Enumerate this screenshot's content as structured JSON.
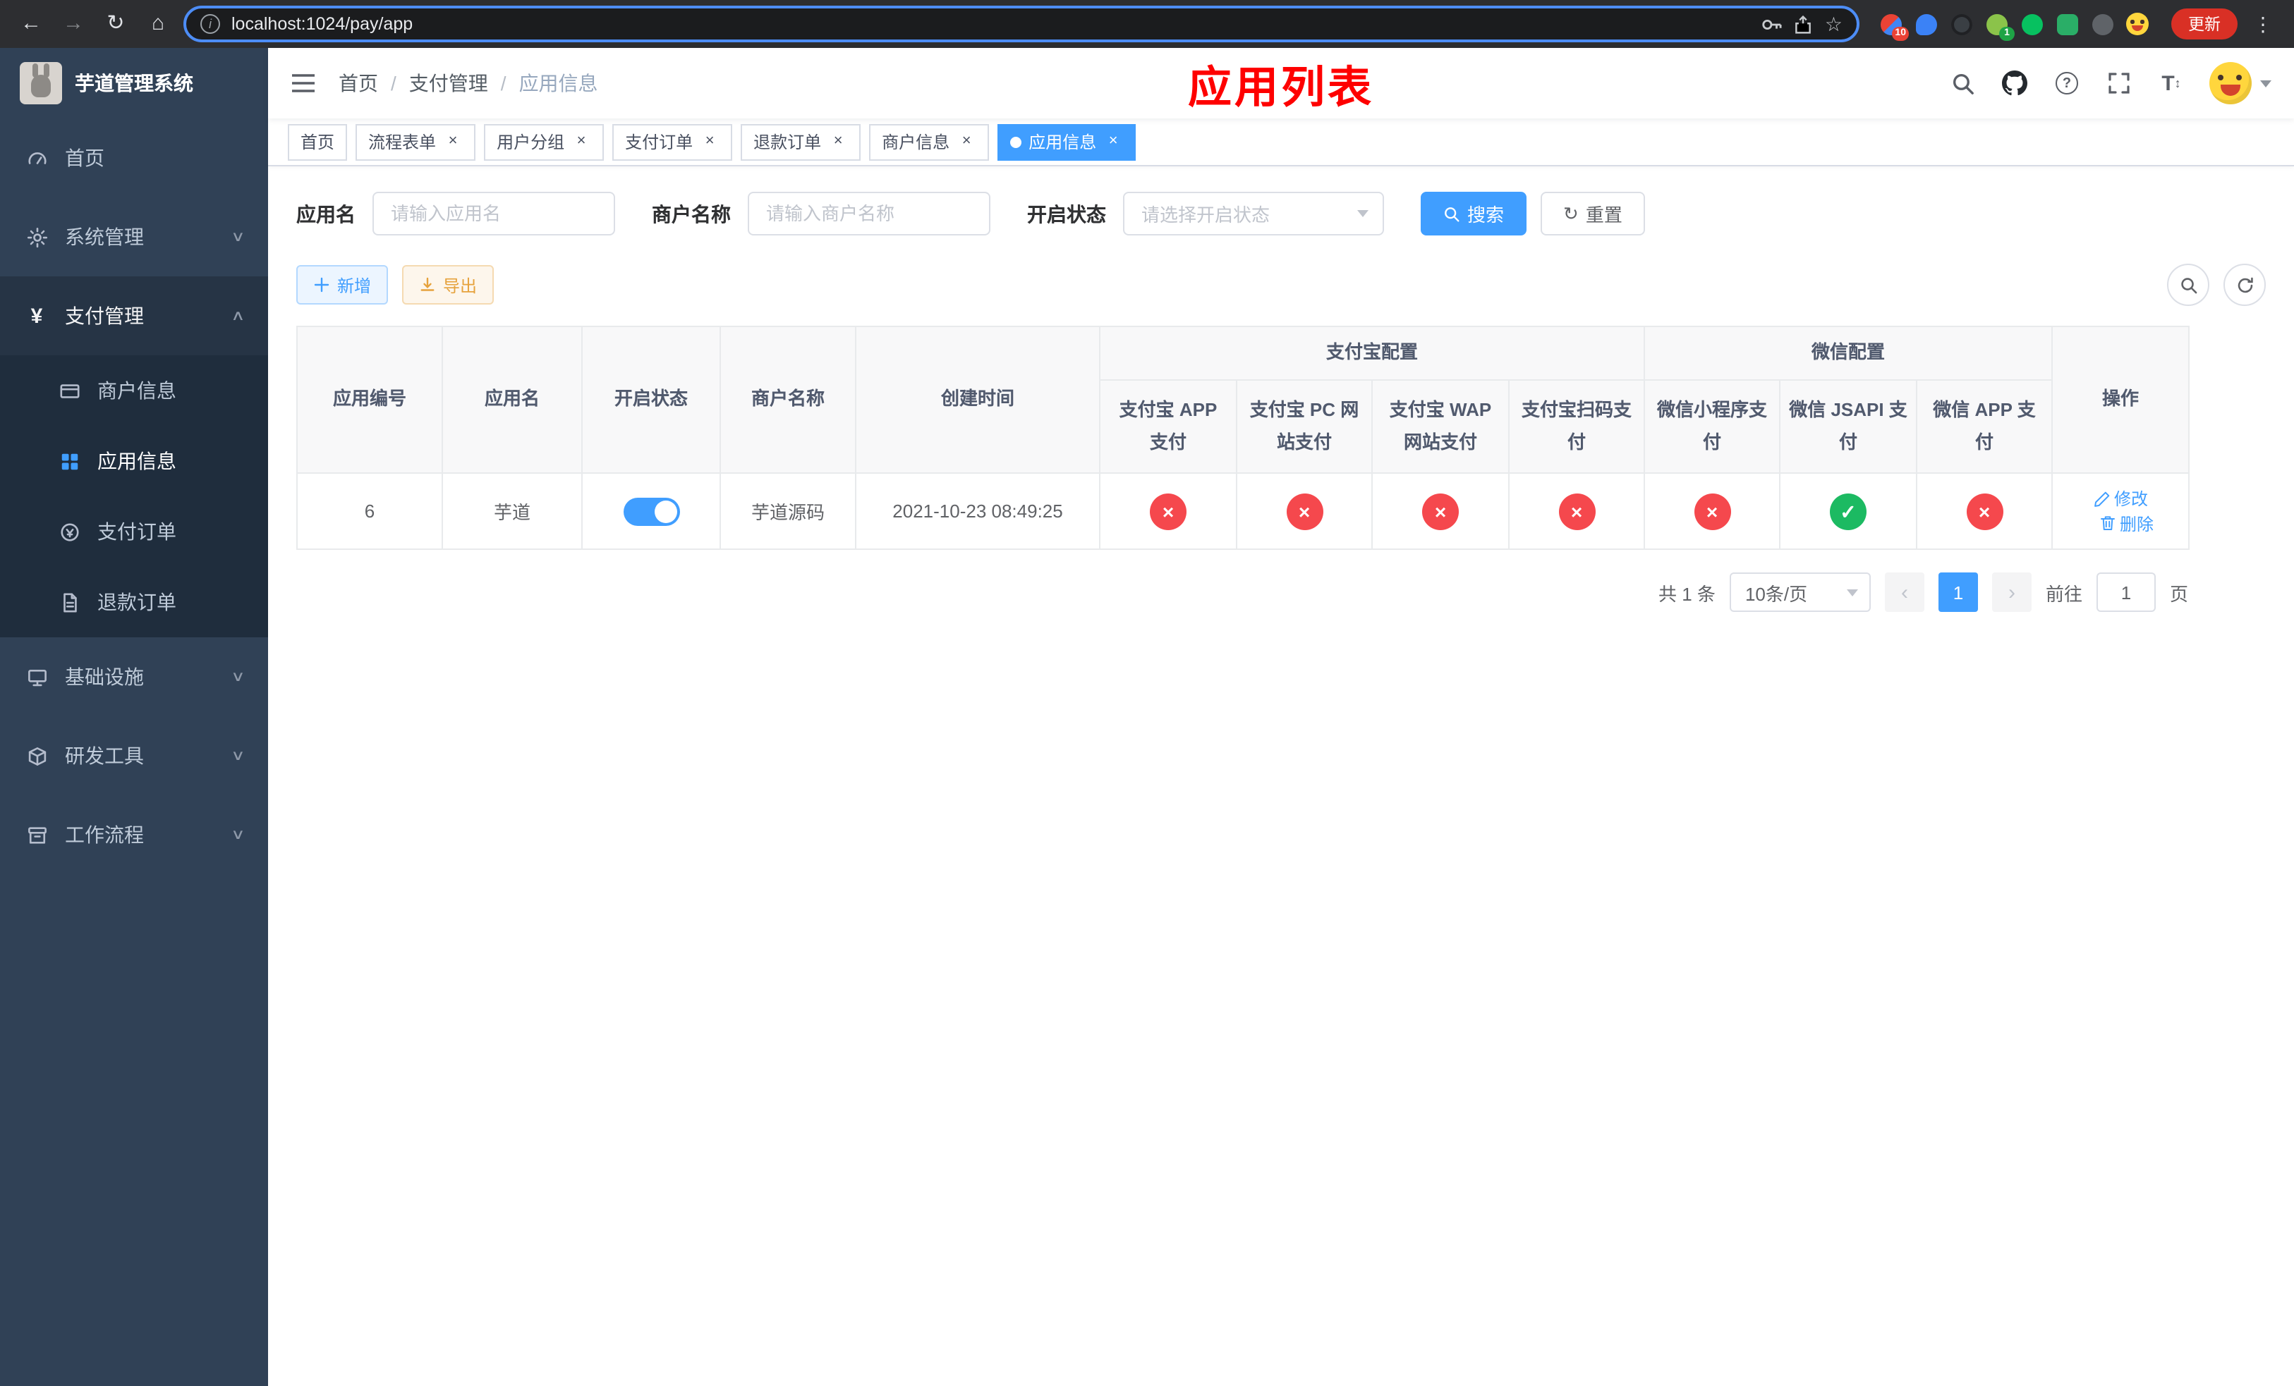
{
  "colors": {
    "accent": "#409EFF",
    "danger": "#f5484d",
    "success": "#1cba62",
    "warning": "#e6a23c",
    "title-red": "#fe0000",
    "sidebar-bg": "#304156",
    "sidebar-sub-bg": "#1f2d3d"
  },
  "browser": {
    "url": "localhost:1024/pay/app",
    "update_label": "更新",
    "ext_badge_count": "10",
    "ext_badge_green": "1"
  },
  "sidebar": {
    "title": "芋道管理系统",
    "items": [
      {
        "label": "首页"
      },
      {
        "label": "系统管理"
      },
      {
        "label": "支付管理",
        "children": [
          {
            "label": "商户信息"
          },
          {
            "label": "应用信息"
          },
          {
            "label": "支付订单"
          },
          {
            "label": "退款订单"
          }
        ]
      },
      {
        "label": "基础设施"
      },
      {
        "label": "研发工具"
      },
      {
        "label": "工作流程"
      }
    ]
  },
  "header": {
    "breadcrumb": [
      "首页",
      "支付管理",
      "应用信息"
    ],
    "page_title": "应用列表"
  },
  "tabs": [
    {
      "label": "首页"
    },
    {
      "label": "流程表单"
    },
    {
      "label": "用户分组"
    },
    {
      "label": "支付订单"
    },
    {
      "label": "退款订单"
    },
    {
      "label": "商户信息"
    },
    {
      "label": "应用信息"
    }
  ],
  "filters": {
    "app_name_label": "应用名",
    "app_name_placeholder": "请输入应用名",
    "merchant_label": "商户名称",
    "merchant_placeholder": "请输入商户名称",
    "status_label": "开启状态",
    "status_placeholder": "请选择开启状态",
    "search_label": "搜索",
    "reset_label": "重置"
  },
  "toolbar": {
    "add_label": "新增",
    "export_label": "导出"
  },
  "table": {
    "columns": {
      "id": "应用编号",
      "name": "应用名",
      "status": "开启状态",
      "merchant": "商户名称",
      "created": "创建时间",
      "alipay_group": "支付宝配置",
      "alipay_app": "支付宝 APP 支付",
      "alipay_pc": "支付宝 PC 网站支付",
      "alipay_wap": "支付宝 WAP 网站支付",
      "alipay_qr": "支付宝扫码支付",
      "wechat_group": "微信配置",
      "wechat_lite": "微信小程序支付",
      "wechat_jsapi": "微信 JSAPI 支付",
      "wechat_app": "微信 APP 支付",
      "actions": "操作"
    },
    "rows": [
      {
        "id": "6",
        "name": "芋道",
        "enabled": true,
        "merchant": "芋道源码",
        "created": "2021-10-23 08:49:25",
        "alipay_app": false,
        "alipay_pc": false,
        "alipay_wap": false,
        "alipay_qr": false,
        "wechat_lite": false,
        "wechat_jsapi": true,
        "wechat_app": false,
        "edit_label": "修改",
        "delete_label": "删除"
      }
    ]
  },
  "pagination": {
    "total": "共 1 条",
    "page_size": "10条/页",
    "page": "1",
    "goto_prefix": "前往",
    "goto_value": "1",
    "goto_suffix": "页"
  }
}
